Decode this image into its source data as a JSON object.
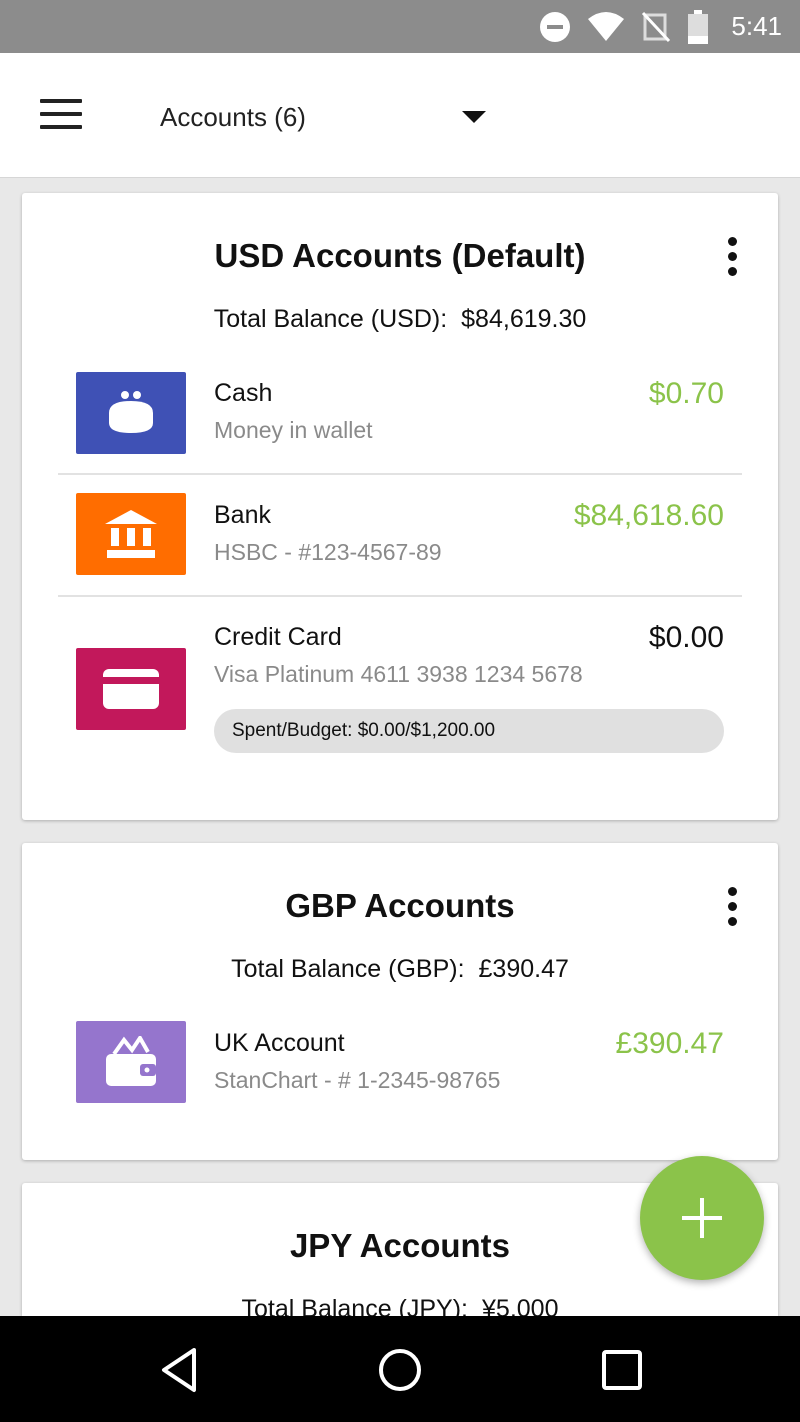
{
  "status_bar": {
    "time": "5:41"
  },
  "app_bar": {
    "title": "Accounts (6)"
  },
  "colors": {
    "positive": "#8bc34a",
    "fab": "#8bc34a",
    "cash_icon_bg": "#3f51b5",
    "bank_icon_bg": "#ff6d00",
    "credit_icon_bg": "#c2185b",
    "uk_icon_bg": "#9575cd"
  },
  "groups": [
    {
      "title": "USD Accounts (Default)",
      "total_label": "Total Balance (USD):",
      "total_value": "$84,619.30",
      "accounts": [
        {
          "icon": "coin-purse-icon",
          "name": "Cash",
          "subtitle": "Money in wallet",
          "amount": "$0.70"
        },
        {
          "icon": "bank-icon",
          "name": "Bank",
          "subtitle": "HSBC - #123-4567-89",
          "amount": "$84,618.60"
        },
        {
          "icon": "credit-card-icon",
          "name": "Credit Card",
          "subtitle": "Visa Platinum 4611 3938 1234 5678",
          "amount": "$0.00",
          "budget": "Spent/Budget: $0.00/$1,200.00"
        }
      ]
    },
    {
      "title": "GBP Accounts",
      "total_label": "Total Balance (GBP):",
      "total_value": "£390.47",
      "accounts": [
        {
          "icon": "wallet-icon",
          "name": "UK Account",
          "subtitle": "StanChart - # 1-2345-98765",
          "amount": "£390.47"
        }
      ]
    },
    {
      "title": "JPY Accounts",
      "total_label": "Total Balance (JPY):",
      "total_value": "¥5,000"
    }
  ]
}
